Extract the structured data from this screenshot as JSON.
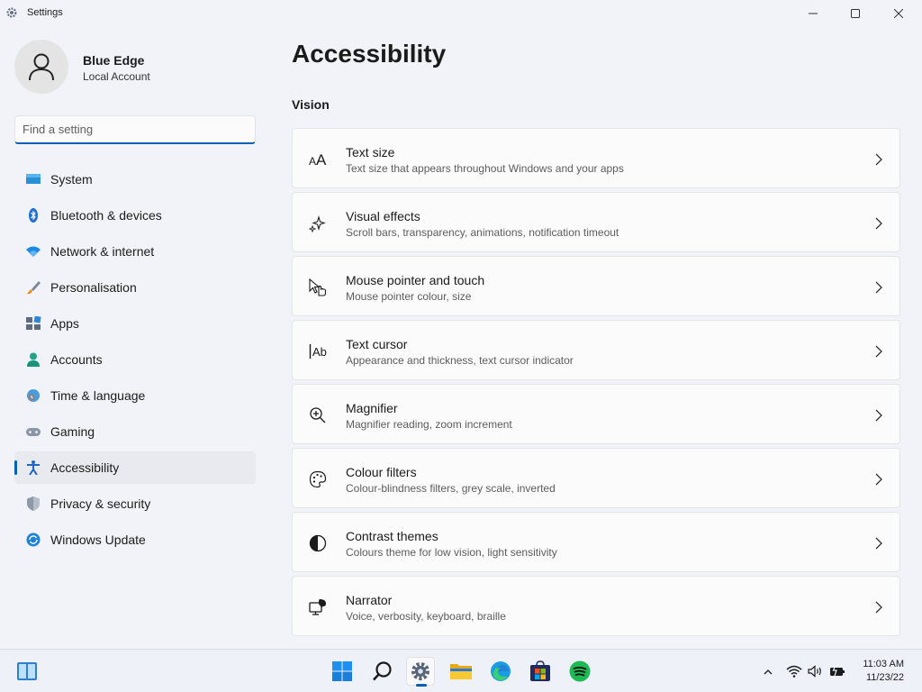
{
  "window": {
    "title": "Settings"
  },
  "profile": {
    "name": "Blue Edge",
    "account_type": "Local Account"
  },
  "search": {
    "placeholder": "Find a setting"
  },
  "nav": [
    {
      "label": "System",
      "icon": "monitor-icon"
    },
    {
      "label": "Bluetooth & devices",
      "icon": "bluetooth-icon"
    },
    {
      "label": "Network & internet",
      "icon": "wifi-icon"
    },
    {
      "label": "Personalisation",
      "icon": "paintbrush-icon"
    },
    {
      "label": "Apps",
      "icon": "apps-icon"
    },
    {
      "label": "Accounts",
      "icon": "person-icon"
    },
    {
      "label": "Time & language",
      "icon": "globe-clock-icon"
    },
    {
      "label": "Gaming",
      "icon": "gamepad-icon"
    },
    {
      "label": "Accessibility",
      "icon": "accessibility-icon",
      "active": true
    },
    {
      "label": "Privacy & security",
      "icon": "shield-icon"
    },
    {
      "label": "Windows Update",
      "icon": "update-icon"
    }
  ],
  "main": {
    "title": "Accessibility",
    "section": "Vision",
    "cards": [
      {
        "title": "Text size",
        "subtitle": "Text size that appears throughout Windows and your apps",
        "icon": "text-size-icon"
      },
      {
        "title": "Visual effects",
        "subtitle": "Scroll bars, transparency, animations, notification timeout",
        "icon": "sparkle-icon"
      },
      {
        "title": "Mouse pointer and touch",
        "subtitle": "Mouse pointer colour, size",
        "icon": "pointer-touch-icon"
      },
      {
        "title": "Text cursor",
        "subtitle": "Appearance and thickness, text cursor indicator",
        "icon": "text-cursor-icon"
      },
      {
        "title": "Magnifier",
        "subtitle": "Magnifier reading, zoom increment",
        "icon": "magnifier-icon"
      },
      {
        "title": "Colour filters",
        "subtitle": "Colour-blindness filters, grey scale, inverted",
        "icon": "palette-icon"
      },
      {
        "title": "Contrast themes",
        "subtitle": "Colours theme for low vision, light sensitivity",
        "icon": "contrast-icon"
      },
      {
        "title": "Narrator",
        "subtitle": "Voice, verbosity, keyboard, braille",
        "icon": "narrator-icon"
      }
    ]
  },
  "taskbar": {
    "apps": [
      "start-icon",
      "search-icon",
      "settings-icon",
      "file-explorer-icon",
      "edge-icon",
      "store-icon",
      "spotify-icon"
    ],
    "clock": {
      "time": "11:03 AM",
      "date": "11/23/22"
    }
  },
  "colors": {
    "accent": "#005fb8",
    "background": "#f1f3f8",
    "card": "#fbfbfc"
  }
}
